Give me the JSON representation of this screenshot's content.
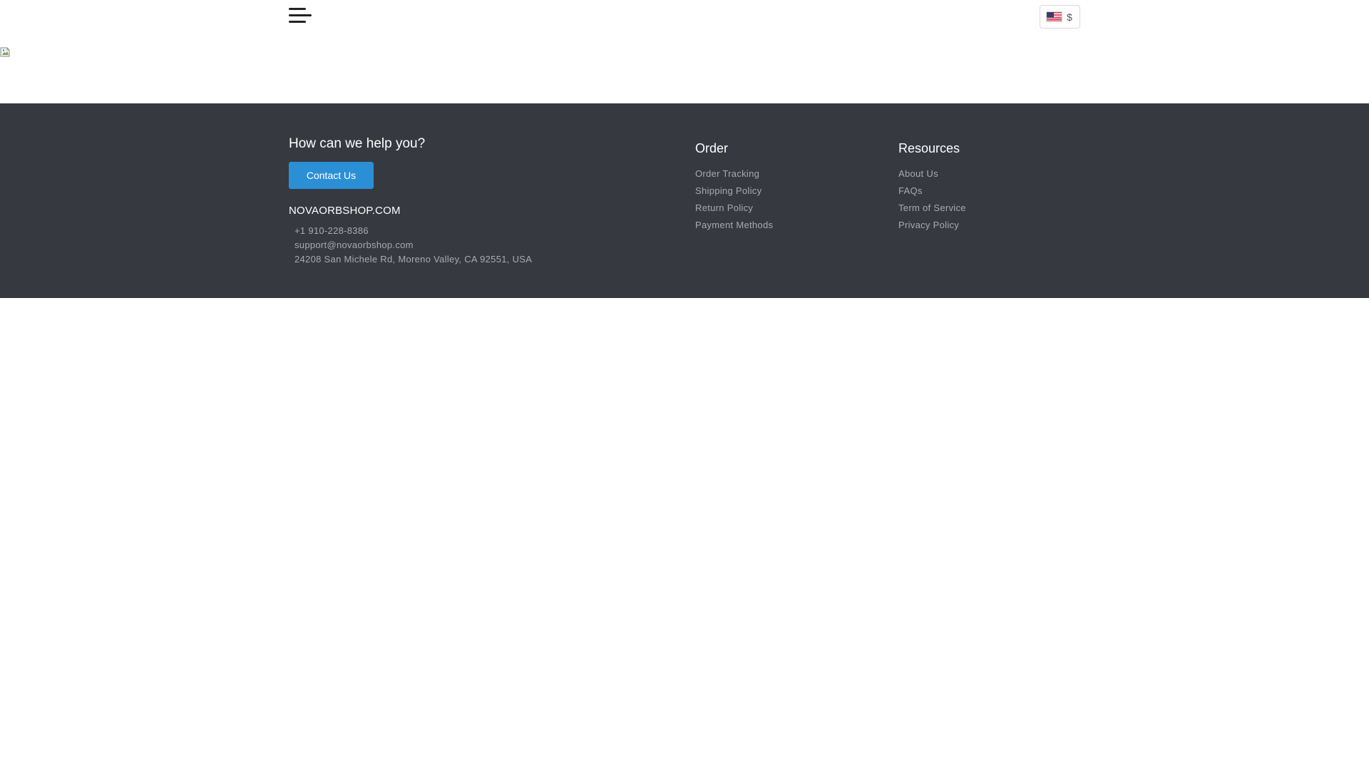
{
  "header": {
    "menu_icon": "hamburger-menu-icon",
    "currency": {
      "flag_icon": "us-flag-icon",
      "symbol": "$"
    }
  },
  "banner": {
    "image_icon": "broken-image-icon"
  },
  "footer": {
    "help_title": "How can we help you?",
    "contact_button": "Contact Us",
    "brand_name": "NOVAORBSHOP.COM",
    "phone": "+1 910-228-8386",
    "email": "support@novaorbshop.com",
    "address": "24208 San Michele Rd, Moreno Valley, CA 92551, USA",
    "order": {
      "title": "Order",
      "links": [
        "Order Tracking",
        "Shipping Policy",
        "Return Policy",
        "Payment Methods"
      ]
    },
    "resources": {
      "title": "Resources",
      "links": [
        "About Us",
        "FAQs",
        "Term of Service",
        "Privacy Policy"
      ]
    },
    "background_color": "#363940",
    "button_color": "#2b8fd6"
  }
}
